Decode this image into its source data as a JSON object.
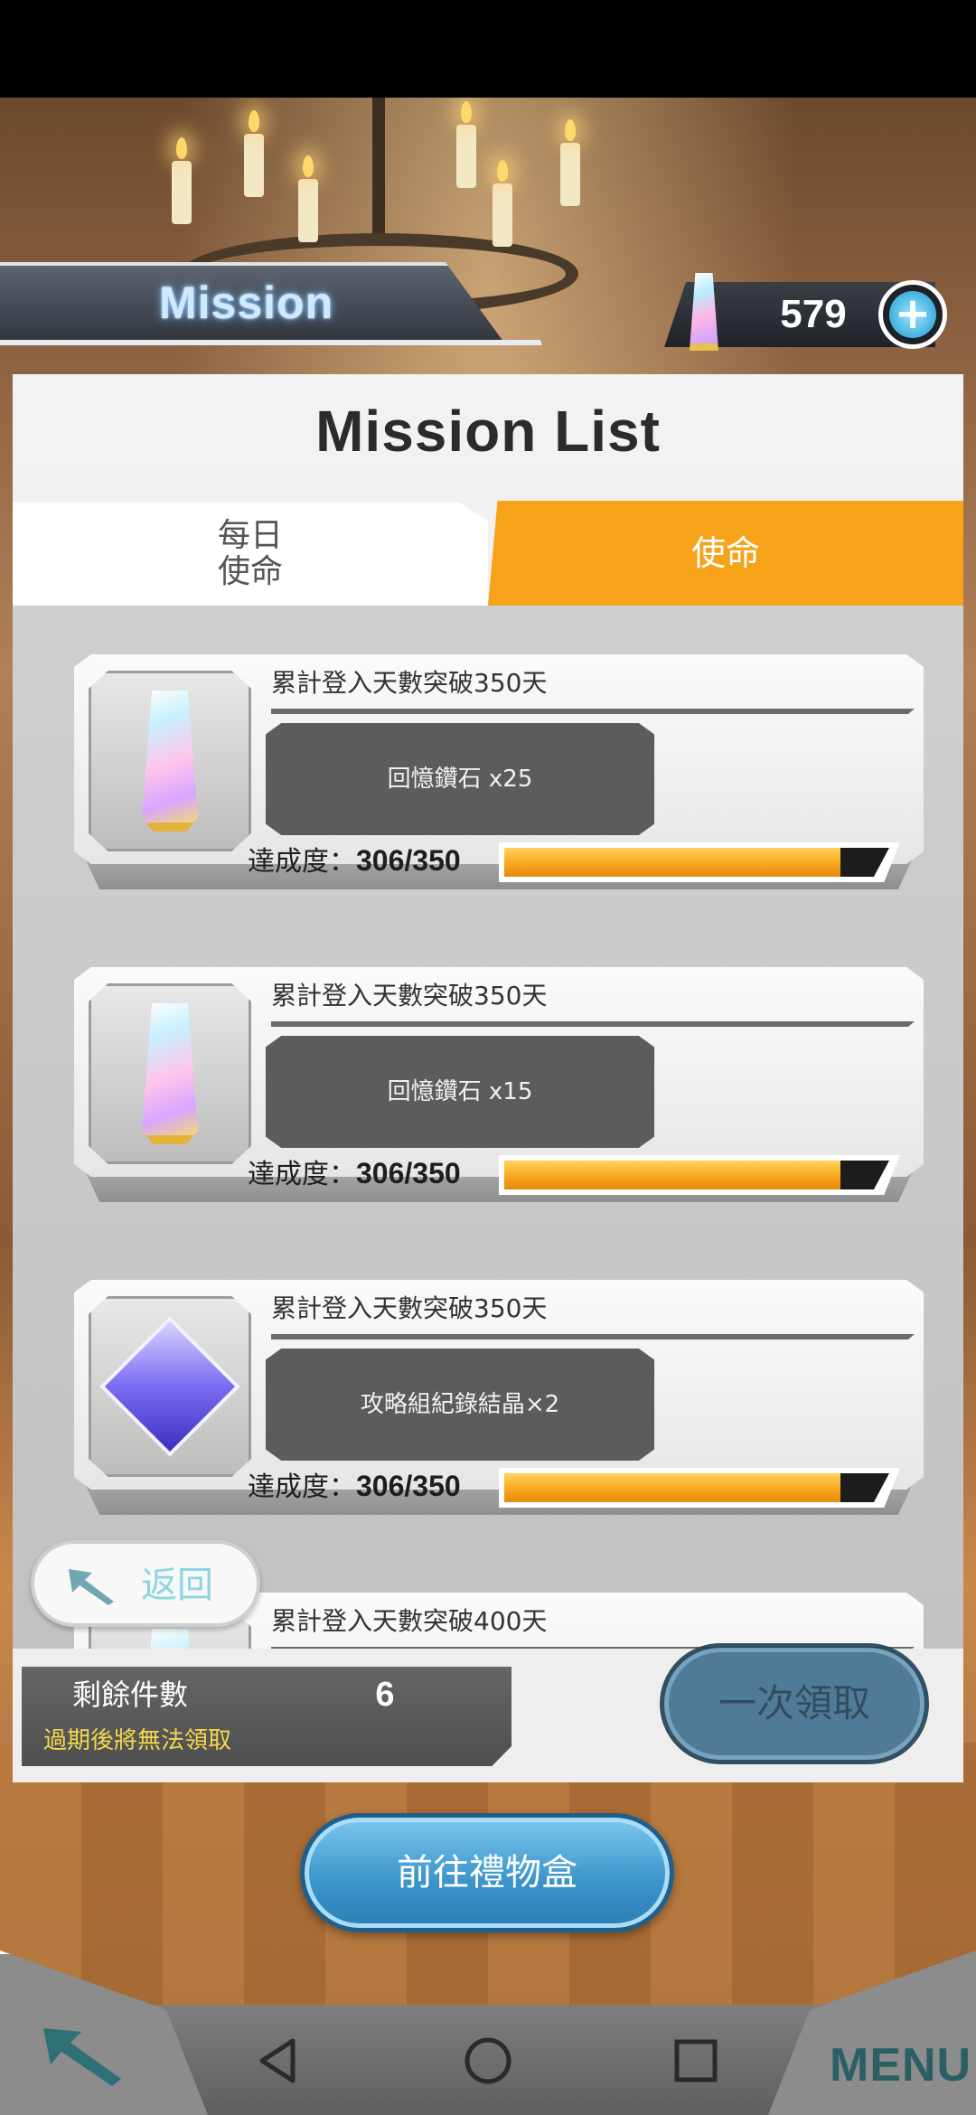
{
  "header": {
    "banner_title": "Mission",
    "gem_count": "579",
    "add_symbol": "+"
  },
  "panel": {
    "title": "Mission List",
    "tabs": [
      {
        "label": "每日\n使命",
        "selected": false
      },
      {
        "label": "使命",
        "selected": true
      }
    ]
  },
  "missions": [
    {
      "name": "累計登入天數突破350天",
      "reward": "回憶鑽石  x25",
      "icon": "memory-diamond-icon",
      "progress_label": "達成度：",
      "progress_text": "306/350",
      "progress": 0.874
    },
    {
      "name": "累計登入天數突破350天",
      "reward": "回憶鑽石  x15",
      "icon": "memory-diamond-icon",
      "progress_label": "達成度：",
      "progress_text": "306/350",
      "progress": 0.874
    },
    {
      "name": "累計登入天數突破350天",
      "reward": "攻略組紀錄結晶×2",
      "icon": "record-crystal-icon",
      "progress_label": "達成度：",
      "progress_text": "306/350",
      "progress": 0.874
    },
    {
      "name": "累計登入天數突破400天"
    }
  ],
  "back_button": {
    "label": "返回"
  },
  "footer": {
    "remaining_label": "剩餘件數",
    "remaining_count": "6",
    "expire_note": "過期後將無法領取",
    "claim_all_label": "一次領取"
  },
  "giftbox_button": {
    "label": "前往禮物盒"
  },
  "bottom_bar": {
    "menu_label": "MENU"
  },
  "colors": {
    "accent_orange": "#f7a31a",
    "progress_fill": "#f7a31a",
    "button_blue": "#3a93c9"
  }
}
